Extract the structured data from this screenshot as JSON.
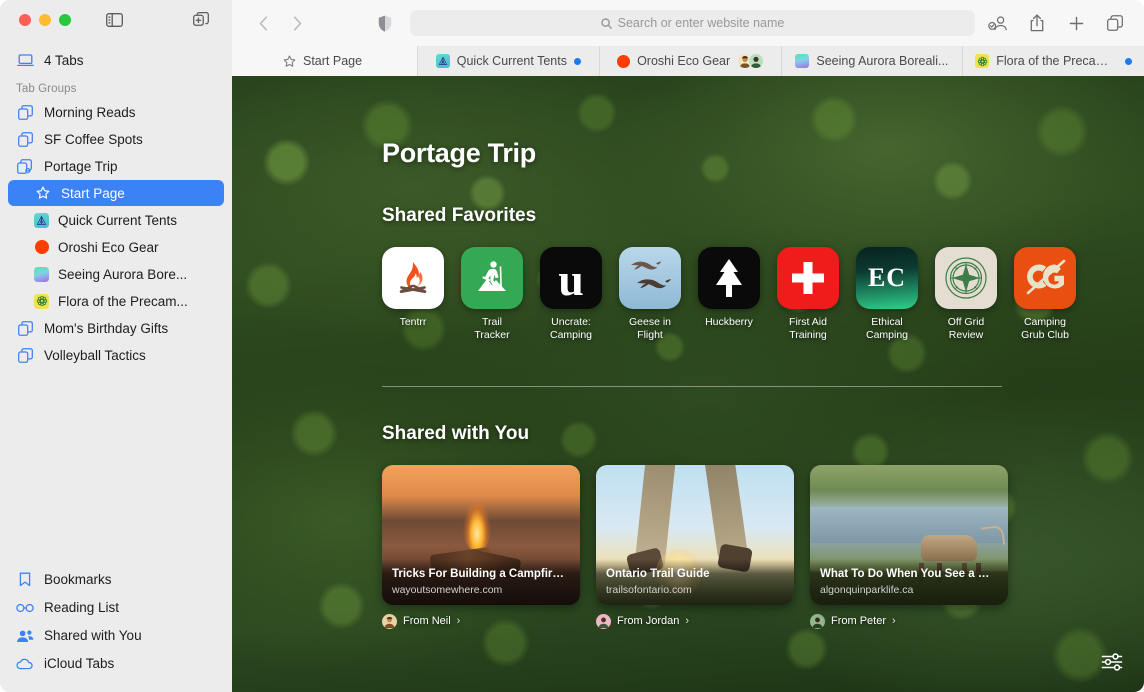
{
  "window": {
    "traffic_lights": [
      "close",
      "minimize",
      "zoom"
    ],
    "sidebar_toggle_label": "Sidebar",
    "new_tab_group_label": "New Tab Group"
  },
  "sidebar": {
    "tabs_row": {
      "label": "4 Tabs",
      "icon": "laptop-icon"
    },
    "section_header": "Tab Groups",
    "groups": [
      {
        "label": "Morning Reads",
        "icon": "tab-group-icon"
      },
      {
        "label": "SF Coffee Spots",
        "icon": "tab-group-icon"
      },
      {
        "label": "Portage Trip",
        "icon": "tab-group-shared-icon"
      }
    ],
    "portage_children": [
      {
        "label": "Start Page",
        "icon": "star-icon",
        "selected": true
      },
      {
        "label": "Quick Current Tents",
        "icon": "favicon-tent",
        "selected": false
      },
      {
        "label": "Oroshi Eco Gear",
        "icon": "favicon-circle-orange",
        "selected": false
      },
      {
        "label": "Seeing Aurora Bore...",
        "icon": "favicon-gradient",
        "selected": false
      },
      {
        "label": "Flora of the Precam...",
        "icon": "favicon-flower",
        "selected": false
      }
    ],
    "groups_after": [
      {
        "label": "Mom's Birthday Gifts",
        "icon": "tab-group-icon"
      },
      {
        "label": "Volleyball Tactics",
        "icon": "tab-group-icon"
      }
    ],
    "bottom_items": [
      {
        "label": "Bookmarks",
        "icon": "bookmark-icon"
      },
      {
        "label": "Reading List",
        "icon": "glasses-icon"
      },
      {
        "label": "Shared with You",
        "icon": "people-icon"
      },
      {
        "label": "iCloud Tabs",
        "icon": "cloud-icon"
      }
    ]
  },
  "toolbar": {
    "back_label": "Back",
    "forward_label": "Forward",
    "shield_label": "Privacy Report",
    "search_placeholder": "Search or enter website name",
    "search_value": "",
    "share_label": "Share",
    "new_tab_label": "New Tab",
    "tab_overview_label": "Tab Overview",
    "profile_label": "Profile"
  },
  "tabbar": {
    "start_tab": {
      "label": "Start Page",
      "icon": "star-icon",
      "active": true
    },
    "tabs": [
      {
        "label": "Quick Current Tents",
        "icon": "favicon-tent",
        "unread": true,
        "avatars": []
      },
      {
        "label": "Oroshi Eco Gear",
        "icon": "favicon-circle-orange",
        "unread": false,
        "avatars": [
          "avatar-neil",
          "avatar-jordan"
        ]
      },
      {
        "label": "Seeing Aurora Boreali...",
        "icon": "favicon-gradient",
        "unread": false,
        "avatars": []
      },
      {
        "label": "Flora of the Precambi...",
        "icon": "favicon-flower",
        "unread": true,
        "avatars": []
      }
    ]
  },
  "startpage": {
    "title": "Portage Trip",
    "favorites_heading": "Shared Favorites",
    "shared_heading": "Shared with You",
    "settings_label": "Customize Start Page",
    "favorites": [
      {
        "label": "Tentrr",
        "icon": "campfire-logo",
        "bg": "#ffffff",
        "fg": "#f4511e"
      },
      {
        "label": "Trail\nTracker",
        "icon": "hiker-logo",
        "bg": "#34a853",
        "fg": "#ffffff"
      },
      {
        "label": "Uncrate:\nCamping",
        "icon": "letter-u-logo",
        "bg": "#0a0a0a",
        "fg": "#ffffff"
      },
      {
        "label": "Geese in\nFlight",
        "icon": "geese-photo",
        "bg": "#a8cbe4",
        "fg": "#4a3a28"
      },
      {
        "label": "Huckberry",
        "icon": "pine-tree-logo",
        "bg": "#0a0a0a",
        "fg": "#ffffff"
      },
      {
        "label": "First Aid\nTraining",
        "icon": "red-cross-logo",
        "bg": "#f01b1b",
        "fg": "#ffffff"
      },
      {
        "label": "Ethical\nCamping",
        "icon": "ec-monogram-logo",
        "bg": "#0b2d2a",
        "fg": "#ffffff"
      },
      {
        "label": "Off Grid\nReview",
        "icon": "compass-logo",
        "bg": "#e4ded2",
        "fg": "#2f6b3a"
      },
      {
        "label": "Camping\nGrub Club",
        "icon": "cg-skewer-logo",
        "bg": "#e94f11",
        "fg": "#e8e3c8"
      }
    ],
    "shared_with_you": [
      {
        "title": "Tricks For Building a Campfire—F...",
        "url": "wayoutsomewhere.com",
        "from": "From Neil",
        "image": "campfire-at-dusk-photo",
        "avatar_color": "#caa874"
      },
      {
        "title": "Ontario Trail Guide",
        "url": "trailsofontario.com",
        "from": "From Jordan",
        "image": "hikers-at-sunset-photo",
        "avatar_color": "#e8a0b4"
      },
      {
        "title": "What To Do When You See a Moo...",
        "url": "algonquinparklife.ca",
        "from": "From Peter",
        "image": "elk-by-pond-photo",
        "avatar_color": "#4f7a4a"
      }
    ]
  },
  "colors": {
    "accent": "#3b82f6",
    "sidebar_bg": "#ececec",
    "toolbar_bg": "#f7f7f7",
    "unread_dot": "#1a7bf0"
  }
}
